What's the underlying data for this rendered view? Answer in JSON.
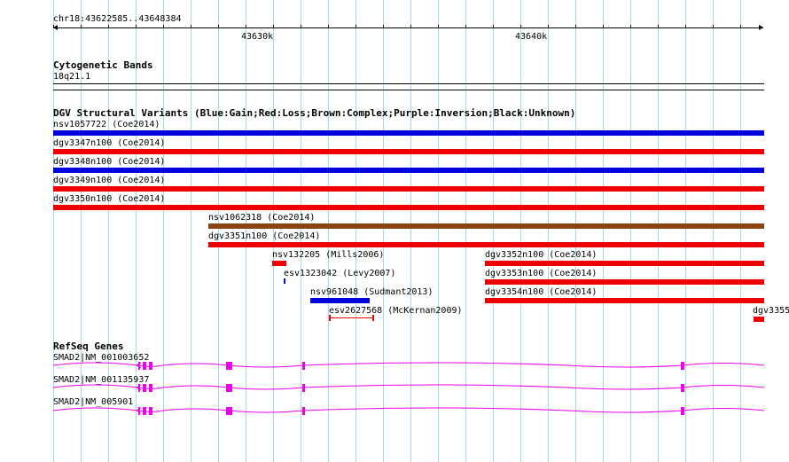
{
  "ruler": {
    "location": "chr18:43622585..43648384",
    "tick_labels": [
      "43630k",
      "43640k"
    ]
  },
  "cytoband": {
    "title": "Cytogenetic Bands",
    "band": "18q21.1"
  },
  "dgv": {
    "title": "DGV Structural Variants (Blue:Gain;Red:Loss;Brown:Complex;Purple:Inversion;Black:Unknown)",
    "colors": {
      "gain": "#0000dd",
      "loss": "#ee0000",
      "complex": "#8b4513"
    },
    "variants": [
      {
        "label": "nsv1057722 (Coe2014)",
        "type": "gain"
      },
      {
        "label": "dgv3347n100 (Coe2014)",
        "type": "loss"
      },
      {
        "label": "dgv3348n100 (Coe2014)",
        "type": "gain"
      },
      {
        "label": "dgv3349n100 (Coe2014)",
        "type": "loss"
      },
      {
        "label": "dgv3350n100 (Coe2014)",
        "type": "loss"
      },
      {
        "label": "nsv1062318 (Coe2014)",
        "type": "complex"
      },
      {
        "label": "dgv3351n100 (Coe2014)",
        "type": "loss"
      },
      {
        "label": "nsv132205 (Mills2006)",
        "type": "loss"
      },
      {
        "label": "dgv3352n100 (Coe2014)",
        "type": "loss"
      },
      {
        "label": "esv1323042 (Levy2007)",
        "type": "gain"
      },
      {
        "label": "dgv3353n100 (Coe2014)",
        "type": "loss"
      },
      {
        "label": "nsv961048 (Sudmant2013)",
        "type": "gain"
      },
      {
        "label": "dgv3354n100 (Coe2014)",
        "type": "loss"
      },
      {
        "label": "esv2627568 (McKernan2009)",
        "type": "loss"
      },
      {
        "label": "dgv3355",
        "type": "loss"
      }
    ]
  },
  "refseq": {
    "title": "RefSeq Genes",
    "color": "#ee00ee",
    "genes": [
      {
        "label": "SMAD2|NM_001003652"
      },
      {
        "label": "SMAD2|NM_001135937"
      },
      {
        "label": "SMAD2|NM_005901"
      }
    ]
  }
}
